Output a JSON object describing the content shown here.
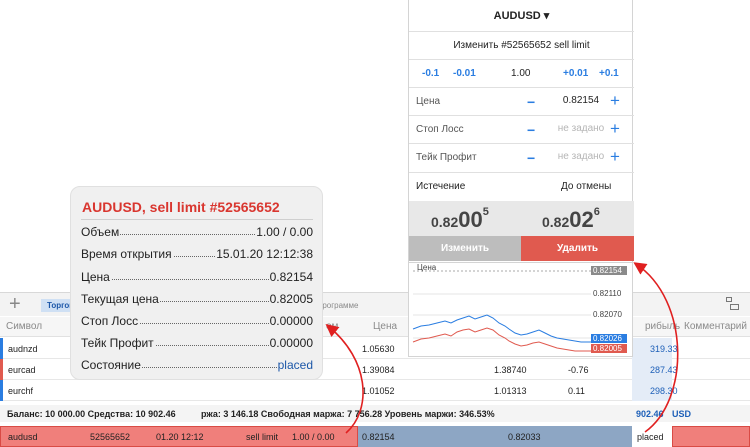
{
  "toolbar": {
    "tab_trade": "Торговля",
    "tab_history": "программе"
  },
  "table": {
    "headers": {
      "symbol": "Символ",
      "vol": "ем",
      "price": "Цена",
      "profit": "рибыль",
      "comment": "Комментарий"
    },
    "rows": [
      {
        "symbol": "audnzd",
        "c1": "1.05630",
        "c2": "",
        "c3": "",
        "profit": "319.33",
        "bar": "#2a7de1"
      },
      {
        "symbol": "eurcad",
        "c1": "1.39084",
        "c2": "1.38740",
        "c3": "-0.76",
        "profit": "287.43",
        "bar": "#e05a4f"
      },
      {
        "symbol": "eurchf",
        "c1": "1.01052",
        "c2": "1.01313",
        "c3": "0.11",
        "profit": "298.30",
        "bar": "#2a7de1"
      }
    ],
    "balance_left": "Баланс: 10 000.00 Средства: 10 902.46",
    "balance_right": "ржа: 3 146.18 Свободная маржа: 7 756.28 Уровень маржи: 346.53%",
    "balance_profit": "902.46",
    "balance_currency": "USD",
    "order": {
      "symbol": "audusd",
      "ticket": "52565652",
      "time": "01.20 12:12",
      "type": "sell limit",
      "volume": "1.00 / 0.00",
      "price": "0.82154",
      "current": "0.82033",
      "state": "placed"
    }
  },
  "dialog": {
    "symbol": "AUDUSD ▾",
    "title": "Изменить #52565652 sell limit",
    "vol_steps": [
      "-0.1",
      "-0.01",
      "1.00",
      "+0.01",
      "+0.1"
    ],
    "fields": [
      {
        "label": "Цена",
        "value": "0.82154"
      },
      {
        "label": "Стоп Лосс",
        "value": "не задано"
      },
      {
        "label": "Тейк Профит",
        "value": "не задано"
      }
    ],
    "expiry_label": "Истечение",
    "expiry_value": "До отмены",
    "bid": {
      "small": "0.82",
      "big": "00",
      "sup": "5"
    },
    "ask": {
      "small": "0.82",
      "big": "02",
      "sup": "6"
    },
    "modify_label": "Изменить",
    "delete_label": "Удалить"
  },
  "chart": {
    "price_label": "Цена",
    "levels": [
      "0.82154",
      "0.82110",
      "0.82070",
      "0.82026",
      "0.82005"
    ],
    "colors": {
      "ask": "#2a7de1",
      "bid": "#e05a4f",
      "level": "#888888"
    }
  },
  "popup": {
    "title": "AUDUSD, sell limit #52565652",
    "rows": [
      {
        "label": "Объем",
        "value": "1.00 / 0.00"
      },
      {
        "label": "Время открытия",
        "value": "15.01.20 12:12:38"
      },
      {
        "label": "Цена",
        "value": "0.82154"
      },
      {
        "label": "Текущая цена",
        "value": "0.82005"
      },
      {
        "label": "Стоп Лосс",
        "value": "0.00000"
      },
      {
        "label": "Тейк Профит",
        "value": "0.00000"
      },
      {
        "label": "Состояние",
        "value": "placed"
      }
    ]
  }
}
